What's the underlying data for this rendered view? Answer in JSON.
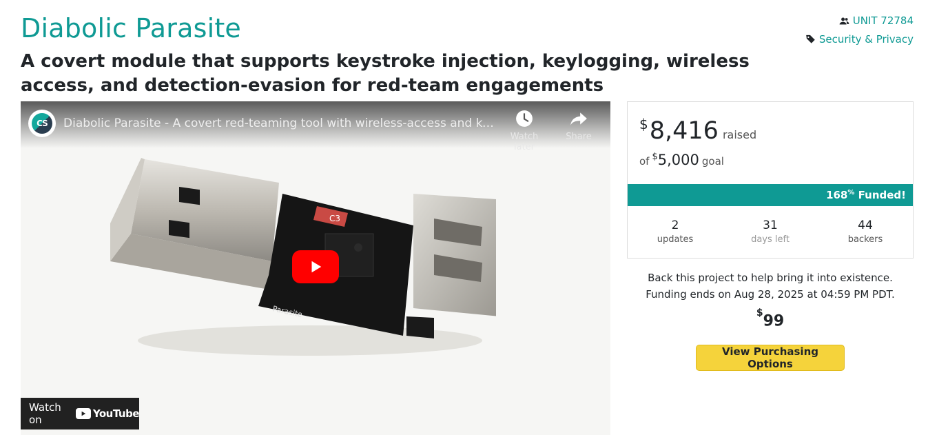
{
  "project": {
    "title": "Diabolic Parasite",
    "subtitle": "A covert module that supports keystroke injection, keylogging, wireless access, and detection-evasion for red-team engagements"
  },
  "links": {
    "creator": "UNIT 72784",
    "category": "Security & Privacy"
  },
  "video": {
    "channel_initials": "CS",
    "title": "Diabolic Parasite - A covert red-teaming tool with wireless-access and keylog...",
    "watch_later": "Watch later",
    "share": "Share",
    "board_label": "Parasite",
    "watch_on": "Watch on",
    "youtube": "YouTube"
  },
  "funding": {
    "currency": "$",
    "raised": "8,416",
    "raised_label": "raised",
    "of_label": "of",
    "goal": "5,000",
    "goal_label": "goal",
    "percent": "168",
    "percent_sign": "%",
    "funded_label": "Funded!",
    "percent_value": 168,
    "stats": [
      {
        "value": "2",
        "label": "updates"
      },
      {
        "value": "31",
        "label": "days left"
      },
      {
        "value": "44",
        "label": "backers"
      }
    ],
    "back_text": "Back this project to help bring it into existence.",
    "ends_text": "Funding ends on Aug 28, 2025 at 04:59 PM PDT."
  },
  "pricing": {
    "currency": "$",
    "price": "99",
    "button_label": "View Purchasing Options"
  },
  "colors": {
    "accent": "#0f9a94",
    "button": "#f5d33b",
    "play": "#ff0000"
  }
}
